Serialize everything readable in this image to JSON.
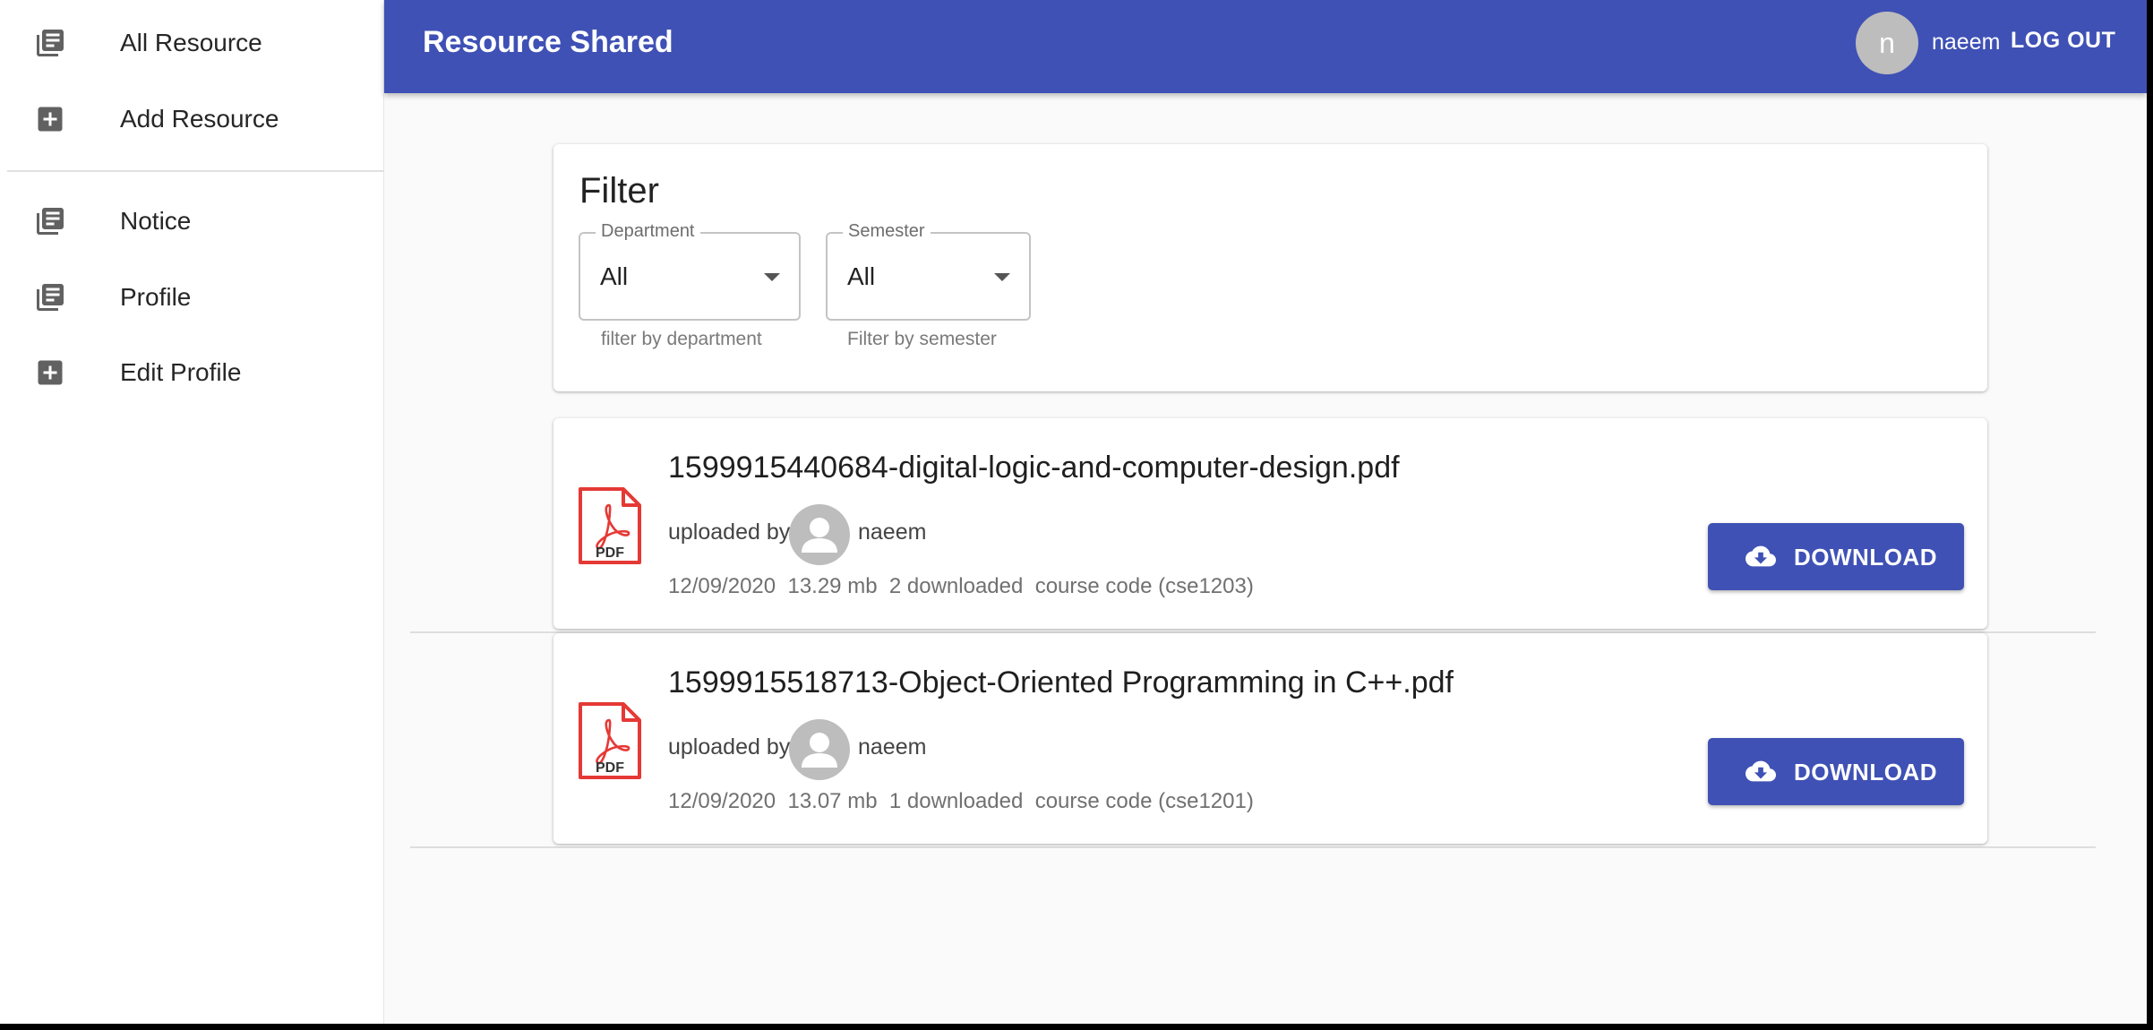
{
  "sidebar": {
    "items": [
      {
        "label": "All Resource",
        "icon": "library-books-icon"
      },
      {
        "label": "Add Resource",
        "icon": "add-box-icon"
      },
      {
        "label": "Notice",
        "icon": "library-books-icon"
      },
      {
        "label": "Profile",
        "icon": "library-books-icon"
      },
      {
        "label": "Edit Profile",
        "icon": "add-box-icon"
      }
    ]
  },
  "header": {
    "title": "Resource Shared",
    "avatar_initial": "n",
    "username": "naeem",
    "logout_label": "LOG OUT",
    "color": "#3f51b5"
  },
  "filter": {
    "title": "Filter",
    "department": {
      "label": "Department",
      "value": "All",
      "helper": "filter by department"
    },
    "semester": {
      "label": "Semester",
      "value": "All",
      "helper": "Filter by semester"
    }
  },
  "resources": [
    {
      "title": "1599915440684-digital-logic-and-computer-design.pdf",
      "uploaded_by_label": "uploaded by",
      "uploader": "naeem",
      "date": "12/09/2020",
      "size": "13.29 mb",
      "downloads": "2 downloaded",
      "course_code": "course code (cse1203)",
      "file_type": "PDF",
      "download_label": "DOWNLOAD"
    },
    {
      "title": "1599915518713-Object-Oriented Programming in C++.pdf",
      "uploaded_by_label": "uploaded by",
      "uploader": "naeem",
      "date": "12/09/2020",
      "size": "13.07 mb",
      "downloads": "1 downloaded",
      "course_code": "course code (cse1201)",
      "file_type": "PDF",
      "download_label": "DOWNLOAD"
    }
  ]
}
